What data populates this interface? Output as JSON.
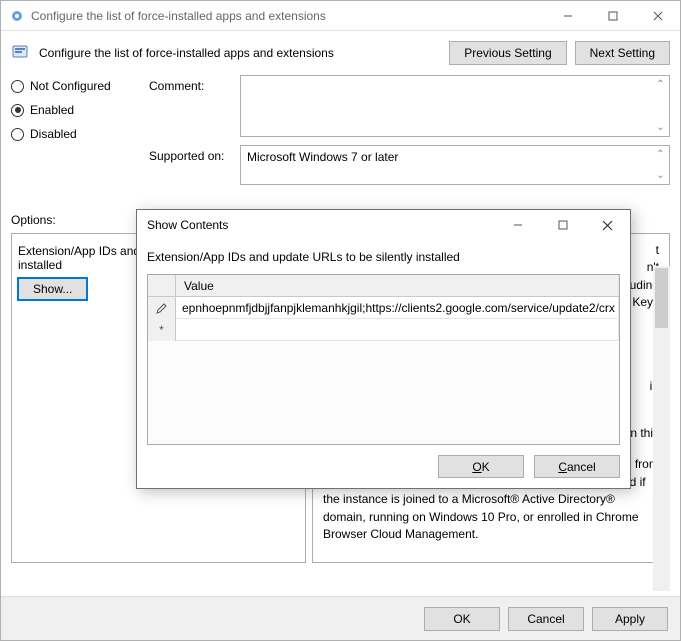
{
  "window": {
    "title": "Configure the list of force-installed apps and extensions"
  },
  "header": {
    "title": "Configure the list of force-installed apps and extensions",
    "prev_label": "Previous Setting",
    "next_label": "Next Setting"
  },
  "state_radios": {
    "not_configured": "Not Configured",
    "enabled": "Enabled",
    "disabled": "Disabled",
    "selected": "enabled"
  },
  "form": {
    "comment_label": "Comment:",
    "comment_value": "",
    "supported_label": "Supported on:",
    "supported_value": "Microsoft Windows 7 or later"
  },
  "options": {
    "section_label": "Options:",
    "field_label": "Extension/App IDs and update URLs to be silently installed",
    "show_btn": "Show..."
  },
  "help": {
    "frag_top": "t\nn't\nluding\nKeys",
    "frag_mid": "in",
    "frag_low": "n this",
    "paragraph": "On Microsoft® Windows® instances, apps and extensions from outside the Chrome Web Store can only be forced installed if the instance is joined to a Microsoft® Active Directory® domain, running on Windows 10 Pro, or enrolled in Chrome Browser Cloud Management."
  },
  "footer": {
    "ok": "OK",
    "cancel": "Cancel",
    "apply": "Apply"
  },
  "modal": {
    "title": "Show Contents",
    "prompt": "Extension/App IDs and update URLs to be silently installed",
    "col_header": "Value",
    "rows": [
      {
        "marker": "pencil",
        "value": "epnhoepnmfjdbjjfanpjklemanhkjgil;https://clients2.google.com/service/update2/crx"
      },
      {
        "marker": "star",
        "value": ""
      }
    ],
    "ok": "OK",
    "cancel": "Cancel"
  }
}
